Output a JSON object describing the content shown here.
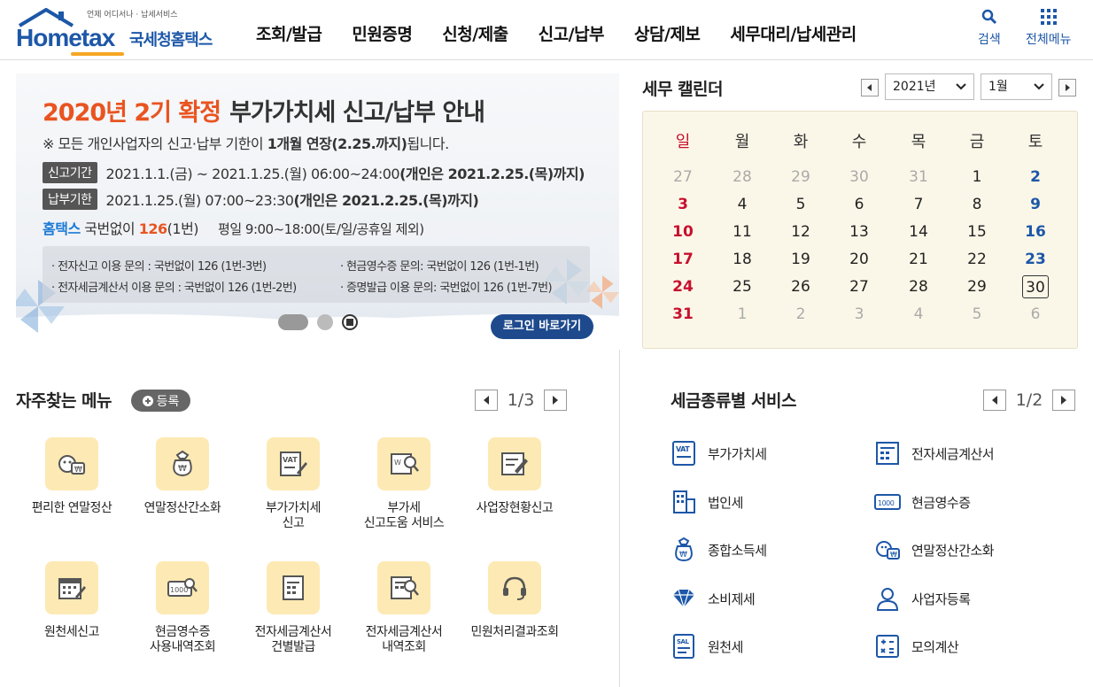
{
  "header": {
    "logo_small": "언제 어디서나 · 납세서비스",
    "logo_brand": "Hometax",
    "logo_kr": "국세청홈택스",
    "nav": [
      "조회/발급",
      "민원증명",
      "신청/제출",
      "신고/납부",
      "상담/제보",
      "세무대리/납세관리"
    ],
    "search_label": "검색",
    "allmenu_label": "전체메뉴"
  },
  "banner": {
    "title_red": "2020년 2기 확정",
    "title_dark": "부가가치세 신고/납부 안내",
    "notice_prefix": "※ 모든 개인사업자의 신고·납부 기한이 ",
    "notice_bold": "1개월 연장(2.25.까지)",
    "notice_suffix": "됩니다.",
    "period_tag": "신고기간",
    "period_text": "2021.1.1.(금) ~ 2021.1.25.(월) 06:00~24:00 ",
    "period_bold": "(개인은 2021.2.25.(목)까지)",
    "pay_tag": "납부기한",
    "pay_text": "2021.1.25.(월) 07:00~23:30 ",
    "pay_bold": "(개인은 2021.2.25.(목)까지)",
    "ht_blue": "홈택스",
    "ht_mid": " 국번없이 ",
    "ht_num": "126",
    "ht_num_suffix": "(1번)",
    "ht_hours": "평일 9:00~18:00(토/일/공휴일 제외)",
    "contact1": "· 전자신고 이용 문의 : 국번없이 126 (1번-3번)",
    "contact2": "· 전자세금계산서 이용 문의 : 국번없이 126 (1번-2번)",
    "contact3": "· 현금영수증 문의: 국번없이 126 (1번-1번)",
    "contact4": "· 증명발급 이용 문의: 국번없이 126 (1번-7번)",
    "login_button": "로그인 바로가기"
  },
  "calendar": {
    "title": "세무 캘린더",
    "year_value": "2021년",
    "month_value": "1월",
    "weekdays": [
      "일",
      "월",
      "화",
      "수",
      "목",
      "금",
      "토"
    ],
    "weeks": [
      [
        "27",
        "28",
        "29",
        "30",
        "31",
        "1",
        "2"
      ],
      [
        "3",
        "4",
        "5",
        "6",
        "7",
        "8",
        "9"
      ],
      [
        "10",
        "11",
        "12",
        "13",
        "14",
        "15",
        "16"
      ],
      [
        "17",
        "18",
        "19",
        "20",
        "21",
        "22",
        "23"
      ],
      [
        "24",
        "25",
        "26",
        "27",
        "28",
        "29",
        "30"
      ],
      [
        "31",
        "1",
        "2",
        "3",
        "4",
        "5",
        "6"
      ]
    ],
    "today": "30"
  },
  "frequent": {
    "title": "자주찾는 메뉴",
    "register": "등록",
    "page": "1/3",
    "items": [
      {
        "label": "편리한 연말정산",
        "icon": "year-end-settlement-icon"
      },
      {
        "label": "연말정산간소화",
        "icon": "money-bag-icon"
      },
      {
        "label": "부가가치세\n신고",
        "icon": "vat-report-icon"
      },
      {
        "label": "부가세\n신고도움 서비스",
        "icon": "vat-help-icon"
      },
      {
        "label": "사업장현황신고",
        "icon": "business-report-icon"
      },
      {
        "label": "원천세신고",
        "icon": "calendar-edit-icon"
      },
      {
        "label": "현금영수증\n사용내역조회",
        "icon": "cash-receipt-search-icon"
      },
      {
        "label": "전자세금계산서\n건별발급",
        "icon": "e-invoice-issue-icon"
      },
      {
        "label": "전자세금계산서\n내역조회",
        "icon": "e-invoice-search-icon"
      },
      {
        "label": "민원처리결과조회",
        "icon": "headset-icon"
      }
    ]
  },
  "services": {
    "title": "세금종류별 서비스",
    "page": "1/2",
    "items": [
      {
        "label": "부가가치세",
        "icon": "vat-icon"
      },
      {
        "label": "전자세금계산서",
        "icon": "e-invoice-icon"
      },
      {
        "label": "법인세",
        "icon": "corporate-tax-icon"
      },
      {
        "label": "현금영수증",
        "icon": "cash-receipt-icon"
      },
      {
        "label": "종합소득세",
        "icon": "income-tax-icon"
      },
      {
        "label": "연말정산간소화",
        "icon": "year-end-icon"
      },
      {
        "label": "소비제세",
        "icon": "diamond-icon"
      },
      {
        "label": "사업자등록",
        "icon": "person-icon"
      },
      {
        "label": "원천세",
        "icon": "withholding-tax-icon"
      },
      {
        "label": "모의계산",
        "icon": "calculator-icon"
      }
    ]
  },
  "colors": {
    "brand_blue": "#1d57a8",
    "accent_orange": "#e95420",
    "icon_tile_bg": "#fde9b3",
    "calendar_bg": "#fbf7e8",
    "sunday_red": "#c8102e",
    "login_button_bg": "#1e4a8d"
  }
}
